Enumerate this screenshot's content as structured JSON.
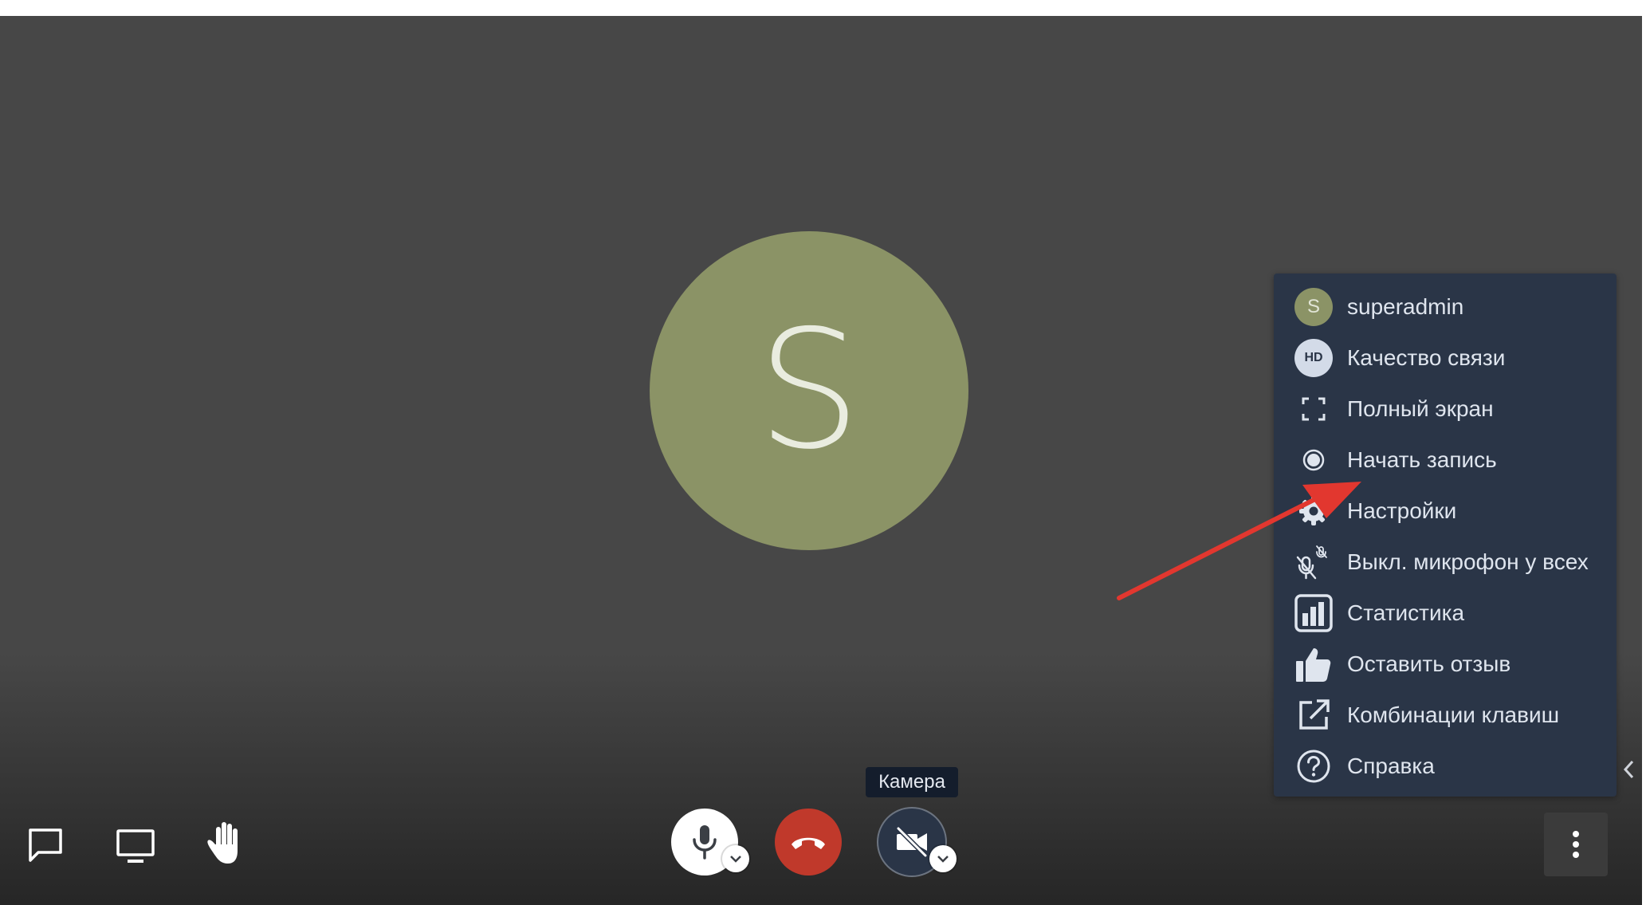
{
  "participant": {
    "initial": "S"
  },
  "menu": {
    "items": [
      {
        "label": "superadmin",
        "icon": "avatar",
        "avatar_initial": "S"
      },
      {
        "label": "Качество связи",
        "icon": "hd-icon",
        "badge": "HD"
      },
      {
        "label": "Полный экран",
        "icon": "fullscreen-icon"
      },
      {
        "label": "Начать запись",
        "icon": "record-icon"
      },
      {
        "label": "Настройки",
        "icon": "gear-icon"
      },
      {
        "label": "Выкл. микрофон у всех",
        "icon": "mute-all-icon"
      },
      {
        "label": "Статистика",
        "icon": "stats-icon"
      },
      {
        "label": "Оставить отзыв",
        "icon": "thumbs-up-icon"
      },
      {
        "label": "Комбинации клавиш",
        "icon": "external-link-icon"
      },
      {
        "label": "Справка",
        "icon": "help-icon"
      }
    ]
  },
  "tooltip": {
    "camera": "Камера"
  },
  "colors": {
    "stage": "#474747",
    "menu_bg": "#2a3547",
    "menu_text": "#dfe5ee",
    "avatar": "#8b9366",
    "hangup": "#c0392b",
    "arrow": "#e2372f"
  }
}
